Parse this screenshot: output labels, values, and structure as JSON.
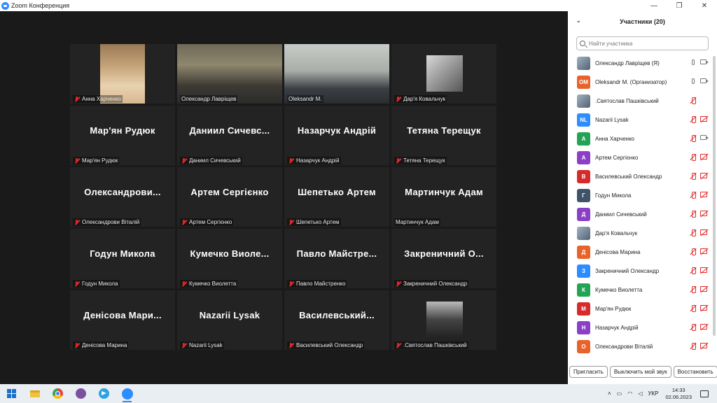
{
  "window": {
    "title": "Zoom Конференция"
  },
  "tiles": [
    {
      "big": "",
      "small": "Анна Харченко",
      "muted": true,
      "photo": "p1"
    },
    {
      "big": "",
      "small": "Олександр Лаврiщев",
      "muted": false,
      "photo": "p2"
    },
    {
      "big": "",
      "small": "Oleksandr M.",
      "muted": false,
      "photo": "p3",
      "active": true
    },
    {
      "big": "",
      "small": "Дар'я Ковальчук",
      "muted": true,
      "photo": "p4"
    },
    {
      "big": "Мар'ян Рудюк",
      "small": "Мар'ян Рудюк",
      "muted": true
    },
    {
      "big": "Даниил Сичевс...",
      "small": "Даниил Сичевський",
      "muted": true
    },
    {
      "big": "Назарчук Андрій",
      "small": "Назарчук Андрій",
      "muted": true
    },
    {
      "big": "Тетяна Терещук",
      "small": "Тетяна Терещук",
      "muted": true
    },
    {
      "big": "Олександрови...",
      "small": "Олександрови Віталій",
      "muted": true
    },
    {
      "big": "Артем Сергієнко",
      "small": "Артем Сергієнко",
      "muted": true
    },
    {
      "big": "Шепетько Артем",
      "small": "Шепетько Артем",
      "muted": true
    },
    {
      "big": "Мартинчук Адам",
      "small": "Мартинчук Адам",
      "muted": false
    },
    {
      "big": "Годун Микола",
      "small": "Годун Микола",
      "muted": true
    },
    {
      "big": "Кумечко Виоле...",
      "small": "Кумечко Виолетта",
      "muted": true
    },
    {
      "big": "Павло Майстре...",
      "small": "Павло Майстренко",
      "muted": true
    },
    {
      "big": "Закреничний О...",
      "small": "Закреничний Олександр",
      "muted": true
    },
    {
      "big": "Денісова Мари...",
      "small": "Денісова Марина",
      "muted": true
    },
    {
      "big": "Nazarii Lysak",
      "small": "Nazarii Lysak",
      "muted": true
    },
    {
      "big": "Василевський...",
      "small": "Василевський Олександр",
      "muted": true
    },
    {
      "big": "",
      "small": ".Святослав Пашківський",
      "muted": true,
      "photo": "p5"
    }
  ],
  "panel": {
    "title": "Участники (20)",
    "search_placeholder": "Найти участника",
    "participants": [
      {
        "name": "Олександр Лаврiщев (Я)",
        "avatar": "",
        "color": "#6b8fa8",
        "mic": "on",
        "cam": "on",
        "img": true
      },
      {
        "name": "Oleksandr M. (Организатор)",
        "avatar": "OM",
        "color": "#e8632b",
        "mic": "on",
        "cam": "on"
      },
      {
        "name": ".Святослав Пашківський",
        "avatar": "",
        "color": "#888888",
        "mic": "off",
        "cam": "none",
        "img": true
      },
      {
        "name": "Nazarii Lysak",
        "avatar": "NL",
        "color": "#2d8cff",
        "mic": "off",
        "cam": "off"
      },
      {
        "name": "Анна Харченко",
        "avatar": "А",
        "color": "#23a455",
        "mic": "off",
        "cam": "on"
      },
      {
        "name": "Артем Сергієнко",
        "avatar": "А",
        "color": "#8a3fc6",
        "mic": "off",
        "cam": "off"
      },
      {
        "name": "Василевський Олександр",
        "avatar": "В",
        "color": "#d72b2b",
        "mic": "off",
        "cam": "off"
      },
      {
        "name": "Годун Микола",
        "avatar": "Г",
        "color": "#3f5468",
        "mic": "off",
        "cam": "off"
      },
      {
        "name": "Даниил Сичевський",
        "avatar": "Д",
        "color": "#8a3fc6",
        "mic": "off",
        "cam": "off"
      },
      {
        "name": "Дар'я Ковальчук",
        "avatar": "",
        "color": "#777777",
        "mic": "off",
        "cam": "off",
        "img": true
      },
      {
        "name": "Денісова Марина",
        "avatar": "Д",
        "color": "#e8632b",
        "mic": "off",
        "cam": "off"
      },
      {
        "name": "Закреничний Олександр",
        "avatar": "З",
        "color": "#2d8cff",
        "mic": "off",
        "cam": "off"
      },
      {
        "name": "Кумечко Виолетта",
        "avatar": "К",
        "color": "#23a455",
        "mic": "off",
        "cam": "off"
      },
      {
        "name": "Мар'ян Рудюк",
        "avatar": "М",
        "color": "#d72b2b",
        "mic": "off",
        "cam": "off"
      },
      {
        "name": "Назарчук Андрій",
        "avatar": "Н",
        "color": "#8a3fc6",
        "mic": "off",
        "cam": "off"
      },
      {
        "name": "Олександрови Віталій",
        "avatar": "О",
        "color": "#e8632b",
        "mic": "off",
        "cam": "off"
      }
    ],
    "buttons": {
      "invite": "Пригласить",
      "mute_me": "Выключить мой звук",
      "restore": "Восстановить"
    }
  },
  "taskbar": {
    "lang": "УКР",
    "time": "14:33",
    "date": "02.06.2023"
  }
}
